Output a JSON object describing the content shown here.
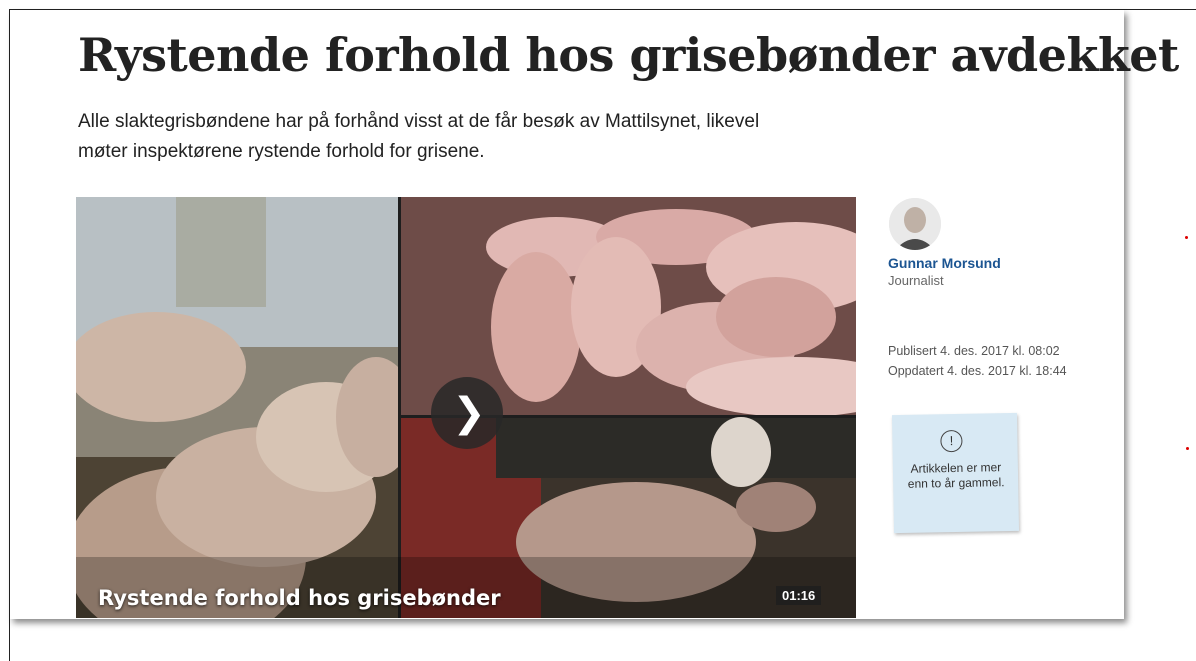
{
  "article": {
    "title": "Rystende forhold hos grisebønder avdekket",
    "lead": "Alle slaktegrisbøndene har på forhånd visst at de får besøk av Mattilsynet, likevel møter inspektørene rystende forhold for grisene."
  },
  "video": {
    "caption": "Rystende forhold hos grisebønder",
    "duration": "01:16",
    "play_icon": "chevron-right-icon"
  },
  "author": {
    "name": "Gunnar Morsund",
    "role": "Journalist"
  },
  "dates": {
    "published": "Publisert 4. des. 2017 kl. 08:02",
    "updated": "Oppdatert 4. des. 2017 kl. 18:44"
  },
  "notice": {
    "icon": "exclamation-circle-icon",
    "text": "Artikkelen er mer enn to år gammel."
  },
  "colors": {
    "author_link": "#1c5592",
    "note_bg": "#d8e9f4"
  }
}
